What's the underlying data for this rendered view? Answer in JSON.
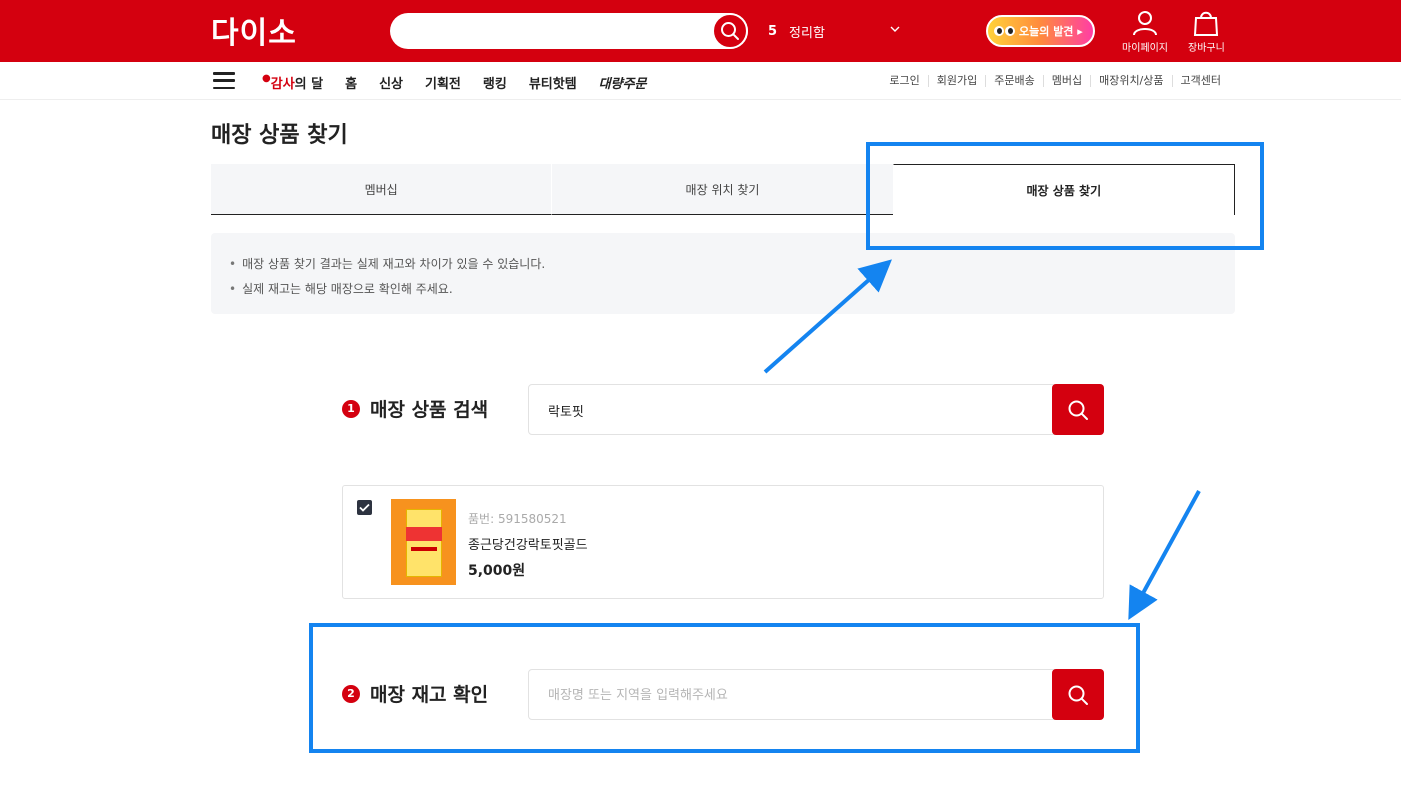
{
  "header": {
    "logo": "다이소",
    "search_placeholder": "",
    "rank_number": "5",
    "rank_keyword": "정리함",
    "discover_label": "오늘의 발견 ▸",
    "mypage_label": "마이페이지",
    "cart_label": "장바구니",
    "brand_color": "#d4000f"
  },
  "nav": {
    "promo_accent": "감사",
    "promo_rest": "의 달",
    "menu": [
      "홈",
      "신상",
      "기획전",
      "랭킹",
      "뷰티핫템"
    ],
    "bulk_order": "대량주문",
    "utility": [
      "로그인",
      "회원가입",
      "주문배송",
      "멤버십",
      "매장위치/상품",
      "고객센터"
    ]
  },
  "page": {
    "title": "매장 상품 찾기",
    "tabs": [
      "멤버십",
      "매장 위치 찾기",
      "매장 상품 찾기"
    ],
    "active_tab": "매장 상품 찾기",
    "notices": [
      "매장 상품 찾기 결과는 실제 재고와 차이가 있을 수 있습니다.",
      "실제 재고는 해당 매장으로 확인해 주세요."
    ]
  },
  "product_search": {
    "step": "1",
    "label": "매장 상품 검색",
    "value": "락토핏"
  },
  "result": {
    "checked": true,
    "code_label": "품번: 591580521",
    "name": "종근당건강락토핏골드",
    "price": "5,000원"
  },
  "stock_check": {
    "step": "2",
    "label": "매장 재고 확인",
    "placeholder": "매장명 또는 지역을 입력해주세요"
  },
  "icons": {
    "search": "search-icon",
    "menu": "hamburger-icon",
    "user": "user-icon",
    "bag": "shopping-bag-icon",
    "check": "check-icon",
    "chevron": "chevron-down-icon"
  },
  "annotation_color": "#1484f0"
}
